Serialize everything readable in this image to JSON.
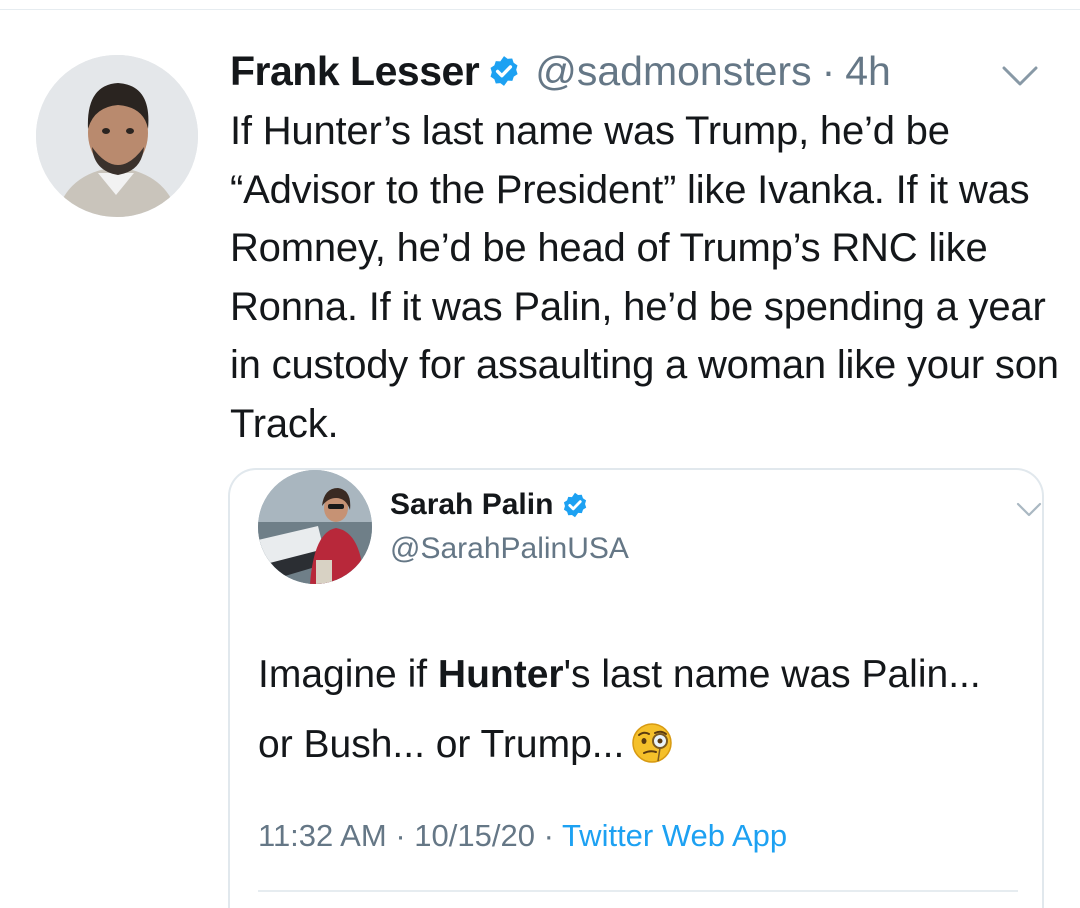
{
  "tweet": {
    "display_name": "Frank Lesser",
    "handle": "@sadmonsters",
    "separator": "·",
    "time_ago": "4h",
    "text": "If Hunter’s last name was Trump, he’d be “Advisor to the President” like Ivanka. If it was Romney, he’d be head of Trump’s RNC like Ronna. If it was Palin, he’d be spending a year in custody for assaulting a woman like your son Track.",
    "avatar_icon": "avatar-photo",
    "verified_icon": "verified-badge-icon",
    "menu_icon": "chevron-down-icon"
  },
  "quoted_tweet": {
    "display_name": "Sarah Palin",
    "handle": "@SarahPalinUSA",
    "text_before": "Imagine if ",
    "text_bold": "Hunter",
    "text_after": "'s last name was Palin... or Bush... or Trump...",
    "emoji_icon": "face-with-monocle-emoji",
    "time": "11:32 AM",
    "separator": "·",
    "date": "10/15/20",
    "source": "Twitter Web App"
  },
  "colors": {
    "text_primary": "#14171a",
    "text_secondary": "#657786",
    "accent": "#1da1f2",
    "border": "#e1e8ed"
  }
}
